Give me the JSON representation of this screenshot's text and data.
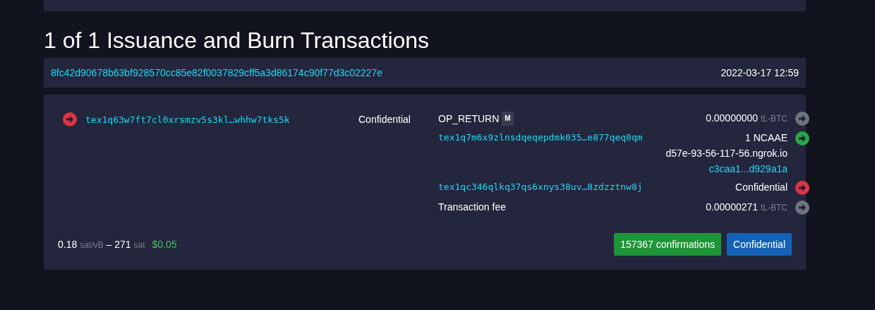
{
  "heading": "1 of 1 Issuance and Burn Transactions",
  "transaction": {
    "txid": "8fc42d90678b63bf928570cc85e82f0037829cff5a3d86174c90f77d3c02227e",
    "time": "2022-03-17 12:59"
  },
  "inputs": [
    {
      "address": "tex1q63w7ft7cl0xrsmzv5s3kl…whhw7tks5k",
      "amount": "Confidential",
      "color": "#dc3545"
    }
  ],
  "outputs": [
    {
      "kind": "text",
      "label": "OP_RETURN",
      "badge": "M",
      "amount": "0.00000000",
      "unit": "tL-BTC",
      "color": "#6c757d"
    },
    {
      "kind": "address",
      "label": "tex1q7m6x9zlnsdqeqepdmk035…e877qeq0qm",
      "amount": "1 NCAAE",
      "domain": "d57e-93-56-117-56.ngrok.io",
      "asset_link": "c3caa1...d929a1a",
      "color": "#28a745"
    },
    {
      "kind": "address",
      "label": "tex1qc346qlkq37qs6xnys38uv…8zdzztnw8j",
      "amount": "Confidential",
      "color": "#dc3545"
    },
    {
      "kind": "text",
      "label": "Transaction fee",
      "amount": "0.00000271",
      "unit": "tL-BTC",
      "color": "#6c757d"
    }
  ],
  "footer": {
    "rate": "0.18",
    "rate_unit": "sat/vB",
    "separator": "–",
    "size": "271",
    "size_unit": "sat",
    "fiat": "$0.05",
    "confirmations": "157367 confirmations",
    "status": "Confidential"
  }
}
